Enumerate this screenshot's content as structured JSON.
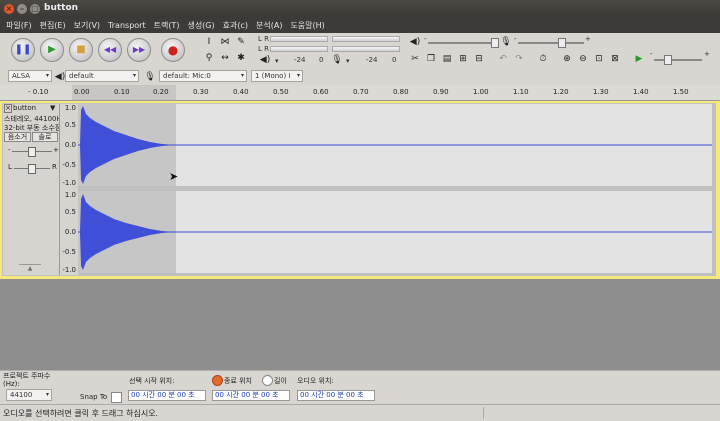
{
  "window": {
    "title": "button"
  },
  "menu": [
    "파일(F)",
    "편집(E)",
    "보기(V)",
    "Transport",
    "트랙(T)",
    "생성(G)",
    "효과(c)",
    "분석(A)",
    "도움말(H)"
  ],
  "meter": {
    "lr_top": "L R",
    "lr_bottom": "L R",
    "db_left": "-24",
    "zero": "0",
    "db_right": "-24",
    "zero2": "0"
  },
  "mixer": {
    "vol_plus": "+",
    "vol_minus": "-",
    "mic_minus": "-",
    "mic_plus": "+"
  },
  "device": {
    "host": "ALSA",
    "output": "default",
    "input": "default: Mic:0",
    "channels": "1 (Mono) I"
  },
  "ruler": {
    "ticks": [
      "- 0.10",
      "0.00",
      "0.10",
      "0.20",
      "0.30",
      "0.40",
      "0.50",
      "0.60",
      "0.70",
      "0.80",
      "0.90",
      "1.00",
      "1.10",
      "1.20",
      "1.30",
      "1.40",
      "1.50"
    ]
  },
  "track": {
    "name": "button",
    "info1": "스테레오, 44100Hz",
    "info2": "32-bit 부동 소수점",
    "mute": "음소거",
    "solo": "솔로",
    "gain_minus": "-",
    "gain_plus": "+",
    "pan_l": "L",
    "pan_r": "R",
    "scale": [
      "1.0",
      "0.5",
      "0.0",
      "-0.5",
      "-1.0"
    ]
  },
  "selection": {
    "rate_label": "프로젝트 주파수 (Hz):",
    "rate_value": "44100",
    "snap_label": "Snap To",
    "start_label": "선택 시작 위치:",
    "end_label": "종료 위치",
    "length_label": "길이",
    "audio_pos_label": "오디오 위치:",
    "time1": "00 시간 00 분 00 초",
    "time2": "00 시간 00 분 00 초",
    "time3": "00 시간 00 분 00 초"
  },
  "status": {
    "text": "오디오를 선택하려면 클릭 후 드래그 하십시오."
  },
  "colors": {
    "waveform": "#3f4fd8",
    "track_focus": "#f6e97a",
    "title_bar": "#3c3b37"
  }
}
